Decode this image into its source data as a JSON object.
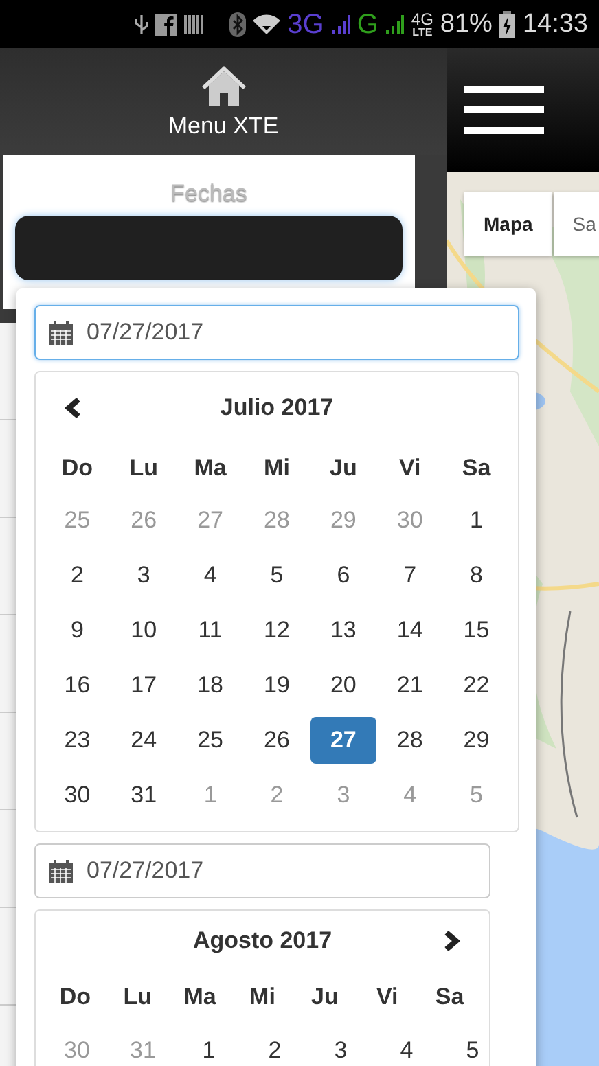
{
  "status_bar": {
    "networks": [
      {
        "label": "3G",
        "color": "#5a3fd0"
      },
      {
        "label": "G",
        "color": "#2f9e1c"
      }
    ],
    "lte": {
      "label": "4G",
      "sub": "LTE"
    },
    "battery": "81%",
    "time": "14:33"
  },
  "sidebar": {
    "title": "Menu XTE",
    "section": "Fechas"
  },
  "map": {
    "tabs": [
      {
        "label": "Mapa",
        "selected": true
      },
      {
        "label": "Sa",
        "selected": false
      }
    ]
  },
  "datepicker": {
    "ranges": [
      {
        "input": {
          "value": "07/27/2017",
          "focused": true
        },
        "calendar": {
          "title": "Julio 2017",
          "kind": "prev",
          "weekdays": [
            "Do",
            "Lu",
            "Ma",
            "Mi",
            "Ju",
            "Vi",
            "Sa"
          ],
          "weeks": [
            [
              {
                "d": "25",
                "muted": true,
                "selected": false
              },
              {
                "d": "26",
                "muted": true,
                "selected": false
              },
              {
                "d": "27",
                "muted": true,
                "selected": false
              },
              {
                "d": "28",
                "muted": true,
                "selected": false
              },
              {
                "d": "29",
                "muted": true,
                "selected": false
              },
              {
                "d": "30",
                "muted": true,
                "selected": false
              },
              {
                "d": "1",
                "muted": false,
                "selected": false
              }
            ],
            [
              {
                "d": "2",
                "muted": false,
                "selected": false
              },
              {
                "d": "3",
                "muted": false,
                "selected": false
              },
              {
                "d": "4",
                "muted": false,
                "selected": false
              },
              {
                "d": "5",
                "muted": false,
                "selected": false
              },
              {
                "d": "6",
                "muted": false,
                "selected": false
              },
              {
                "d": "7",
                "muted": false,
                "selected": false
              },
              {
                "d": "8",
                "muted": false,
                "selected": false
              }
            ],
            [
              {
                "d": "9",
                "muted": false,
                "selected": false
              },
              {
                "d": "10",
                "muted": false,
                "selected": false
              },
              {
                "d": "11",
                "muted": false,
                "selected": false
              },
              {
                "d": "12",
                "muted": false,
                "selected": false
              },
              {
                "d": "13",
                "muted": false,
                "selected": false
              },
              {
                "d": "14",
                "muted": false,
                "selected": false
              },
              {
                "d": "15",
                "muted": false,
                "selected": false
              }
            ],
            [
              {
                "d": "16",
                "muted": false,
                "selected": false
              },
              {
                "d": "17",
                "muted": false,
                "selected": false
              },
              {
                "d": "18",
                "muted": false,
                "selected": false
              },
              {
                "d": "19",
                "muted": false,
                "selected": false
              },
              {
                "d": "20",
                "muted": false,
                "selected": false
              },
              {
                "d": "21",
                "muted": false,
                "selected": false
              },
              {
                "d": "22",
                "muted": false,
                "selected": false
              }
            ],
            [
              {
                "d": "23",
                "muted": false,
                "selected": false
              },
              {
                "d": "24",
                "muted": false,
                "selected": false
              },
              {
                "d": "25",
                "muted": false,
                "selected": false
              },
              {
                "d": "26",
                "muted": false,
                "selected": false
              },
              {
                "d": "27",
                "muted": false,
                "selected": true
              },
              {
                "d": "28",
                "muted": false,
                "selected": false
              },
              {
                "d": "29",
                "muted": false,
                "selected": false
              }
            ],
            [
              {
                "d": "30",
                "muted": false,
                "selected": false
              },
              {
                "d": "31",
                "muted": false,
                "selected": false
              },
              {
                "d": "1",
                "muted": true,
                "selected": false
              },
              {
                "d": "2",
                "muted": true,
                "selected": false
              },
              {
                "d": "3",
                "muted": true,
                "selected": false
              },
              {
                "d": "4",
                "muted": true,
                "selected": false
              },
              {
                "d": "5",
                "muted": true,
                "selected": false
              }
            ]
          ]
        }
      },
      {
        "input": {
          "value": "07/27/2017",
          "focused": false
        },
        "calendar": {
          "title": "Agosto 2017",
          "kind": "next",
          "weekdays": [
            "Do",
            "Lu",
            "Ma",
            "Mi",
            "Ju",
            "Vi",
            "Sa"
          ],
          "weeks": [
            [
              {
                "d": "30",
                "muted": true,
                "selected": false
              },
              {
                "d": "31",
                "muted": true,
                "selected": false
              },
              {
                "d": "1",
                "muted": false,
                "selected": false
              },
              {
                "d": "2",
                "muted": false,
                "selected": false
              },
              {
                "d": "3",
                "muted": false,
                "selected": false
              },
              {
                "d": "4",
                "muted": false,
                "selected": false
              },
              {
                "d": "5",
                "muted": false,
                "selected": false
              }
            ]
          ]
        }
      }
    ]
  }
}
